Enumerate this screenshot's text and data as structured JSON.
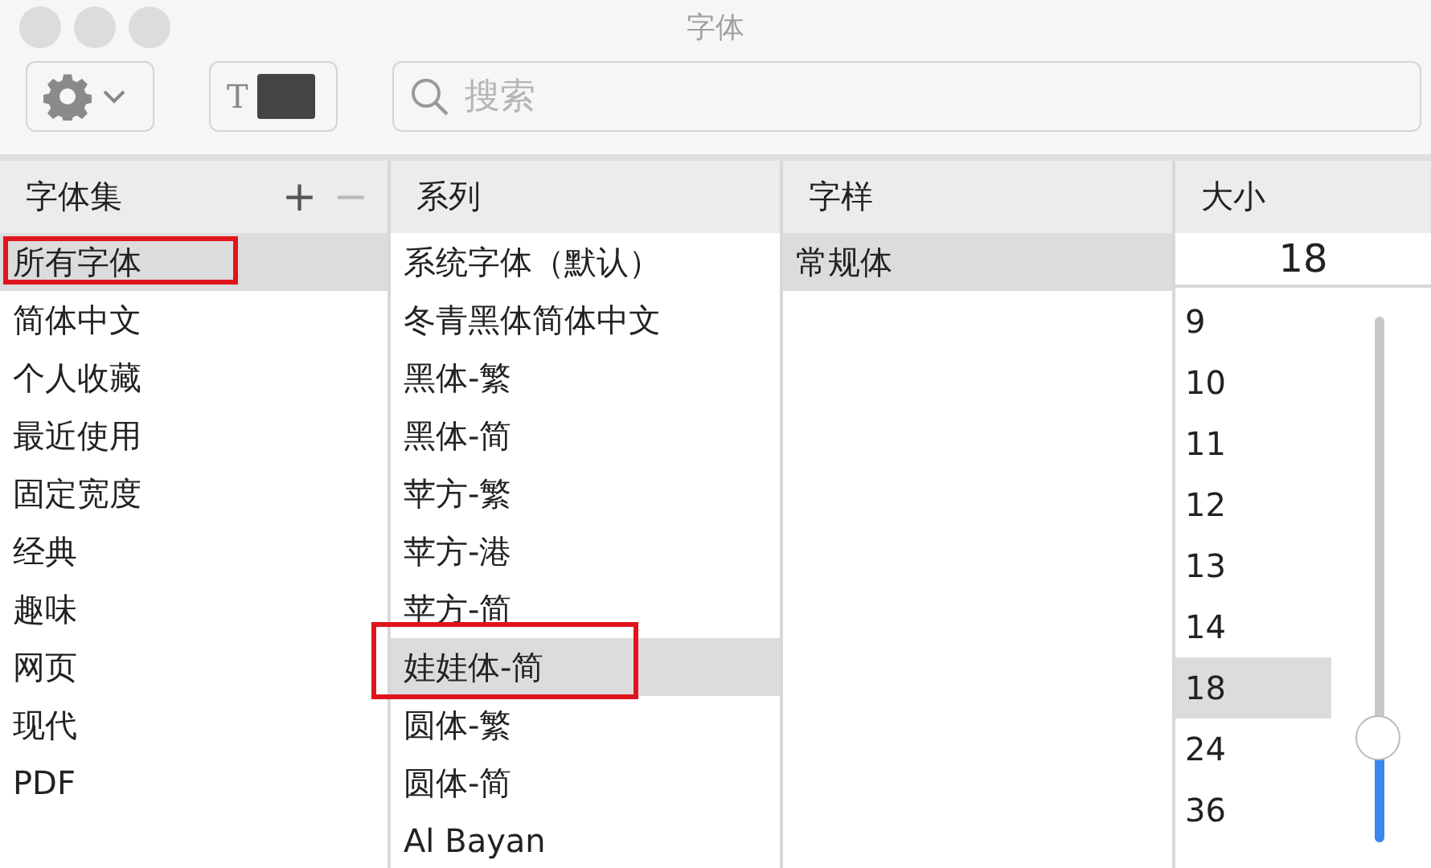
{
  "window": {
    "title": "字体"
  },
  "toolbar": {
    "text_color_label": "T",
    "search": {
      "placeholder": "搜索"
    }
  },
  "collections": {
    "header": "字体集",
    "add": "+",
    "remove": "−",
    "items": [
      {
        "label": "所有字体",
        "selected": true,
        "marked": true
      },
      {
        "label": "简体中文",
        "selected": false,
        "marked": false
      },
      {
        "label": "个人收藏",
        "selected": false,
        "marked": false
      },
      {
        "label": "最近使用",
        "selected": false,
        "marked": false
      },
      {
        "label": "固定宽度",
        "selected": false,
        "marked": false
      },
      {
        "label": "经典",
        "selected": false,
        "marked": false
      },
      {
        "label": "趣味",
        "selected": false,
        "marked": false
      },
      {
        "label": "网页",
        "selected": false,
        "marked": false
      },
      {
        "label": "现代",
        "selected": false,
        "marked": false
      },
      {
        "label": "PDF",
        "selected": false,
        "marked": false
      }
    ]
  },
  "families": {
    "header": "系列",
    "items": [
      {
        "label": "系统字体（默认）",
        "selected": false,
        "marked": false
      },
      {
        "label": "冬青黑体简体中文",
        "selected": false,
        "marked": false
      },
      {
        "label": "黑体-繁",
        "selected": false,
        "marked": false
      },
      {
        "label": "黑体-简",
        "selected": false,
        "marked": false
      },
      {
        "label": "苹方-繁",
        "selected": false,
        "marked": false
      },
      {
        "label": "苹方-港",
        "selected": false,
        "marked": false
      },
      {
        "label": "苹方-简",
        "selected": false,
        "marked": false
      },
      {
        "label": "娃娃体-简",
        "selected": true,
        "marked": true
      },
      {
        "label": "圆体-繁",
        "selected": false,
        "marked": false
      },
      {
        "label": "圆体-简",
        "selected": false,
        "marked": false
      },
      {
        "label": "Al Bayan",
        "selected": false,
        "marked": false
      }
    ]
  },
  "typefaces": {
    "header": "字样",
    "items": [
      {
        "label": "常规体",
        "selected": true,
        "marked": false
      }
    ]
  },
  "sizes": {
    "header": "大小",
    "value": "18",
    "slider": {
      "level": 0.2
    },
    "items": [
      {
        "label": "9",
        "selected": false
      },
      {
        "label": "10",
        "selected": false
      },
      {
        "label": "11",
        "selected": false
      },
      {
        "label": "12",
        "selected": false
      },
      {
        "label": "13",
        "selected": false
      },
      {
        "label": "14",
        "selected": false
      },
      {
        "label": "18",
        "selected": true
      },
      {
        "label": "24",
        "selected": false
      },
      {
        "label": "36",
        "selected": false
      }
    ]
  }
}
